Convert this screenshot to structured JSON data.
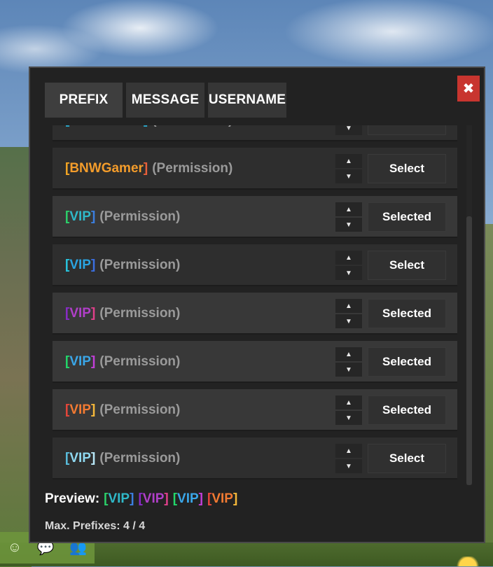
{
  "window": {
    "close_label": "✖",
    "tabs": [
      {
        "label": "PREFIX",
        "active": true
      },
      {
        "label": "MESSAGE",
        "active": false
      },
      {
        "label": "USERNAME",
        "active": false
      }
    ]
  },
  "arrows": {
    "up": "▲",
    "down": "▼"
  },
  "prefixes": [
    {
      "segments": [
        {
          "t": "[BNWGamer]",
          "c": "#2aa7c9"
        }
      ],
      "perm": "(Permission)",
      "button": "Select",
      "highlight": false
    },
    {
      "segments": [
        {
          "t": "[",
          "c": "#f5a623"
        },
        {
          "t": "BNWGamer",
          "c": "#f39c2b"
        },
        {
          "t": "]",
          "c": "#e8603a"
        }
      ],
      "perm": "(Permission)",
      "button": "Select",
      "highlight": false
    },
    {
      "segments": [
        {
          "t": "[",
          "c": "#2bd16a"
        },
        {
          "t": "VIP",
          "c": "#2fb8c8"
        },
        {
          "t": "]",
          "c": "#3b7fe0"
        }
      ],
      "perm": "(Permission)",
      "button": "Selected",
      "highlight": true
    },
    {
      "segments": [
        {
          "t": "[",
          "c": "#27c6e0"
        },
        {
          "t": "VIP",
          "c": "#2aa3e0"
        },
        {
          "t": "]",
          "c": "#3b6fe0"
        }
      ],
      "perm": "(Permission)",
      "button": "Select",
      "highlight": false
    },
    {
      "segments": [
        {
          "t": "[",
          "c": "#8a2bc9"
        },
        {
          "t": "VIP",
          "c": "#b03fc8"
        },
        {
          "t": "]",
          "c": "#e0408a"
        }
      ],
      "perm": "(Permission)",
      "button": "Selected",
      "highlight": true
    },
    {
      "segments": [
        {
          "t": "[",
          "c": "#22d86a"
        },
        {
          "t": "VIP",
          "c": "#3aa6e8"
        },
        {
          "t": "]",
          "c": "#c23fd8"
        }
      ],
      "perm": "(Permission)",
      "button": "Selected",
      "highlight": true
    },
    {
      "segments": [
        {
          "t": "[",
          "c": "#e8463a"
        },
        {
          "t": "VIP",
          "c": "#f27a32"
        },
        {
          "t": "]",
          "c": "#f5b83a"
        }
      ],
      "perm": "(Permission)",
      "button": "Selected",
      "highlight": true
    },
    {
      "segments": [
        {
          "t": "[",
          "c": "#5ac0e0"
        },
        {
          "t": "VIP",
          "c": "#8fd8f0"
        },
        {
          "t": "]",
          "c": "#b8e8f8"
        }
      ],
      "perm": "(Permission)",
      "button": "Select",
      "highlight": false
    }
  ],
  "preview": {
    "label": "Preview:",
    "tags": [
      {
        "segments": [
          {
            "t": "[",
            "c": "#2bd16a"
          },
          {
            "t": "VIP",
            "c": "#2fb8c8"
          },
          {
            "t": "]",
            "c": "#3b7fe0"
          }
        ]
      },
      {
        "segments": [
          {
            "t": "[",
            "c": "#8a2bc9"
          },
          {
            "t": "VIP",
            "c": "#b03fc8"
          },
          {
            "t": "]",
            "c": "#e0408a"
          }
        ]
      },
      {
        "segments": [
          {
            "t": "[",
            "c": "#22d86a"
          },
          {
            "t": "VIP",
            "c": "#3aa6e8"
          },
          {
            "t": "]",
            "c": "#c23fd8"
          }
        ]
      },
      {
        "segments": [
          {
            "t": "[",
            "c": "#e8463a"
          },
          {
            "t": "VIP",
            "c": "#f27a32"
          },
          {
            "t": "]",
            "c": "#f5b83a"
          }
        ]
      }
    ]
  },
  "max_prefixes": "Max. Prefixes: 4 / 4",
  "hud": {
    "icons": [
      "smile-icon",
      "chat-icon",
      "add-friend-icon"
    ]
  }
}
